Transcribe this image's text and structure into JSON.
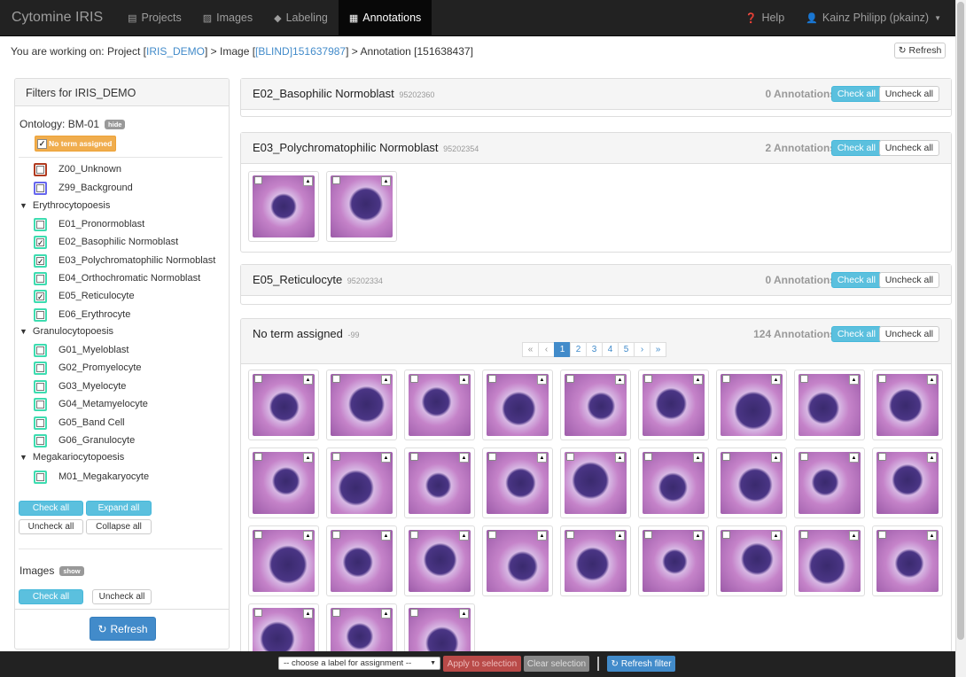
{
  "navbar": {
    "brand": "Cytomine IRIS",
    "items": [
      {
        "label": "Projects",
        "icon": "list-icon"
      },
      {
        "label": "Images",
        "icon": "picture-icon"
      },
      {
        "label": "Labeling",
        "icon": "tag-icon"
      },
      {
        "label": "Annotations",
        "icon": "grid-icon",
        "active": true
      }
    ],
    "help": "Help",
    "user": "Kainz Philipp (pkainz)"
  },
  "breadcrumb": {
    "prefix": "You are working on: Project [",
    "project": "IRIS_DEMO",
    "mid1": "] > Image [",
    "image": "[BLIND]151637987",
    "mid2": "] > Annotation [151638437]",
    "refresh": "Refresh"
  },
  "filters": {
    "title": "Filters for IRIS_DEMO",
    "ontology": "Ontology: BM-01",
    "hide": "hide",
    "no_term": "No term assigned",
    "terms": [
      {
        "label": "Z00_Unknown",
        "color": "#b03a1f",
        "checked": false
      },
      {
        "label": "Z99_Background",
        "color": "#6666ee",
        "checked": false
      }
    ],
    "groups": [
      {
        "label": "Erythrocytopoesis",
        "terms": [
          {
            "label": "E01_Pronormoblast",
            "checked": false
          },
          {
            "label": "E02_Basophilic Normoblast",
            "checked": true
          },
          {
            "label": "E03_Polychromatophilic Normoblast",
            "checked": true
          },
          {
            "label": "E04_Orthochromatic Normoblast",
            "checked": false
          },
          {
            "label": "E05_Reticulocyte",
            "checked": true
          },
          {
            "label": "E06_Erythrocyte",
            "checked": false
          }
        ]
      },
      {
        "label": "Granulocytopoesis",
        "terms": [
          {
            "label": "G01_Myeloblast",
            "checked": false
          },
          {
            "label": "G02_Promyelocyte",
            "checked": false
          },
          {
            "label": "G03_Myelocyte",
            "checked": false
          },
          {
            "label": "G04_Metamyelocyte",
            "checked": false
          },
          {
            "label": "G05_Band Cell",
            "checked": false
          },
          {
            "label": "G06_Granulocyte",
            "checked": false
          }
        ]
      },
      {
        "label": "Megakariocytopoesis",
        "terms": [
          {
            "label": "M01_Megakaryocyte",
            "checked": false
          }
        ]
      }
    ],
    "term_color": "#3ddcb0",
    "check_all": "Check all",
    "expand_all": "Expand all",
    "uncheck_all": "Uncheck all",
    "collapse_all": "Collapse all",
    "images_label": "Images",
    "show": "show",
    "images_check_all": "Check all",
    "images_uncheck_all": "Uncheck all",
    "refresh": "Refresh"
  },
  "panels": [
    {
      "title": "E02_Basophilic Normoblast",
      "id": "95202360",
      "count": "0 Annotations",
      "check": "Check all",
      "uncheck": "Uncheck all",
      "thumbs": 0
    },
    {
      "title": "E03_Polychromatophilic Normoblast",
      "id": "95202354",
      "count": "2 Annotations",
      "check": "Check all",
      "uncheck": "Uncheck all",
      "thumbs": 2
    },
    {
      "title": "E05_Reticulocyte",
      "id": "95202334",
      "count": "0 Annotations",
      "check": "Check all",
      "uncheck": "Uncheck all",
      "thumbs": 0
    },
    {
      "title": "No term assigned",
      "id": "-99",
      "count": "124 Annotations",
      "check": "Check all",
      "uncheck": "Uncheck all",
      "thumbs": 30
    }
  ],
  "pager": [
    "«",
    "‹",
    "1",
    "2",
    "3",
    "4",
    "5",
    "›",
    "»"
  ],
  "bottombar": {
    "select": "-- choose a label for assignment --",
    "apply": "Apply to selection",
    "clear": "Clear selection",
    "refresh_filter": "Refresh filter"
  }
}
